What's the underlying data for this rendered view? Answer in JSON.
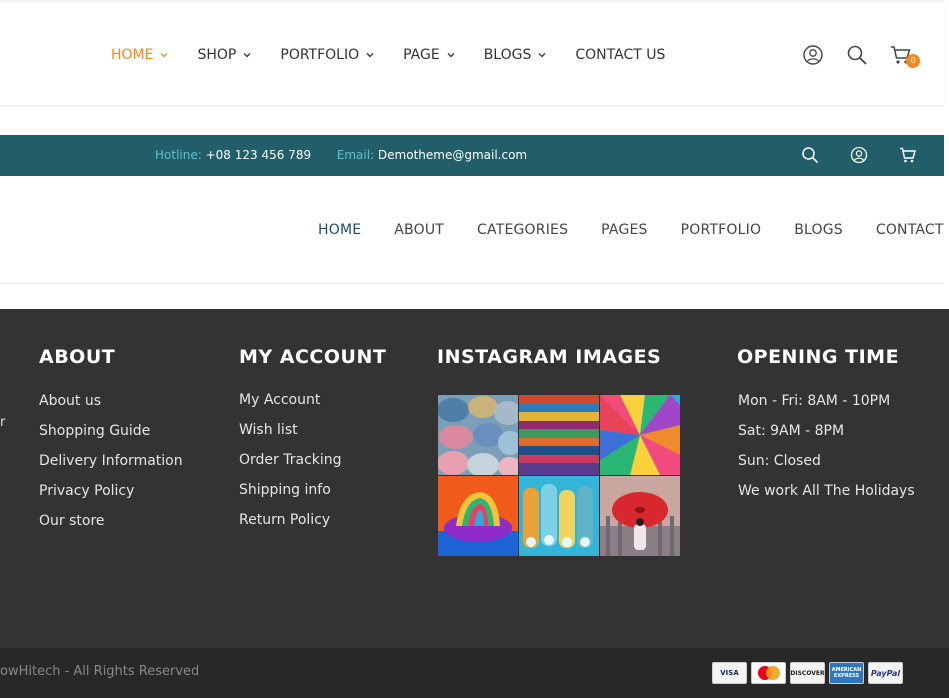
{
  "header1": {
    "nav": [
      {
        "label": "HOME",
        "has_dropdown": true,
        "active": true
      },
      {
        "label": "SHOP",
        "has_dropdown": true
      },
      {
        "label": "PORTFOLIO",
        "has_dropdown": true
      },
      {
        "label": "PAGE",
        "has_dropdown": true
      },
      {
        "label": "BLOGS",
        "has_dropdown": true
      },
      {
        "label": "CONTACT US",
        "has_dropdown": false
      }
    ],
    "icons": [
      "user-icon",
      "search-icon",
      "cart-icon"
    ],
    "cart_count": "0",
    "accent_color": "#f28a1d"
  },
  "topbar": {
    "hotline_label": "Hotline:",
    "hotline_value": "+08 123 456 789",
    "email_label": "Email:",
    "email_value": "Demotheme@gmail.com",
    "bg_color": "#215e6a",
    "icons": [
      "search-icon",
      "user-icon",
      "cart-icon"
    ]
  },
  "header2": {
    "nav": [
      "HOME",
      "ABOUT",
      "CATEGORIES",
      "PAGES",
      "PORTFOLIO",
      "BLOGS",
      "CONTACT"
    ],
    "active": "HOME"
  },
  "footer": {
    "stray_text": "r",
    "about": {
      "title": "ABOUT",
      "links": [
        "About us",
        "Shopping Guide",
        "Delivery Information",
        "Privacy Policy",
        "Our store"
      ]
    },
    "account": {
      "title": "MY ACCOUNT",
      "links": [
        "My Account",
        "Wish list",
        "Order Tracking",
        "Shipping info",
        "Return Policy"
      ]
    },
    "instagram": {
      "title": "INSTAGRAM IMAGES",
      "images": [
        "towels-image",
        "fabrics-image",
        "balloon-image",
        "rainbow-hat-image",
        "thread-spools-image",
        "red-umbrella-image"
      ]
    },
    "hours": {
      "title": "OPENING TIME",
      "lines": [
        "Mon - Fri: 8AM - 10PM",
        "Sat: 9AM - 8PM",
        "Sun: Closed",
        "We work All The Holidays"
      ]
    }
  },
  "bottom": {
    "copyright": "owHitech - All Rights Reserved",
    "payments": [
      "VISA",
      "MasterCard",
      "DISCOVER",
      "AMERICAN EXPRESS",
      "PayPal"
    ]
  }
}
